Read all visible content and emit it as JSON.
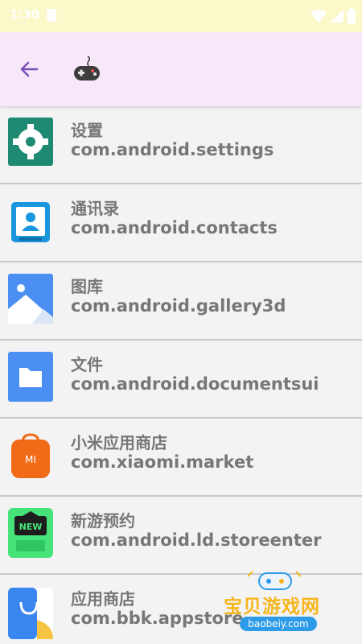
{
  "status_bar": {
    "time": "1:30"
  },
  "app_bar": {
    "back_icon": "arrow-back-icon",
    "title_icon": "gamepad-emoji-icon"
  },
  "apps": [
    {
      "name": "设置",
      "package": "com.android.settings",
      "icon": "settings-gear-icon"
    },
    {
      "name": "通讯录",
      "package": "com.android.contacts",
      "icon": "contacts-icon"
    },
    {
      "name": "图库",
      "package": "com.android.gallery3d",
      "icon": "gallery-icon"
    },
    {
      "name": "文件",
      "package": "com.android.documentsui",
      "icon": "files-folder-icon"
    },
    {
      "name": "小米应用商店",
      "package": "com.xiaomi.market",
      "icon": "xiaomi-market-icon"
    },
    {
      "name": "新游预约",
      "package": "com.android.ld.storeenter",
      "icon": "new-game-icon"
    },
    {
      "name": "应用商店",
      "package": "com.bbk.appstore",
      "icon": "appstore-icon"
    }
  ],
  "watermark": {
    "text": "宝贝游戏网",
    "url": "baobeiy.com"
  },
  "colors": {
    "accent": "#7a4fb5",
    "status_bar": "#fbf8c9",
    "app_bar": "#f6e8f8",
    "list_bg": "#f3f3f3"
  }
}
